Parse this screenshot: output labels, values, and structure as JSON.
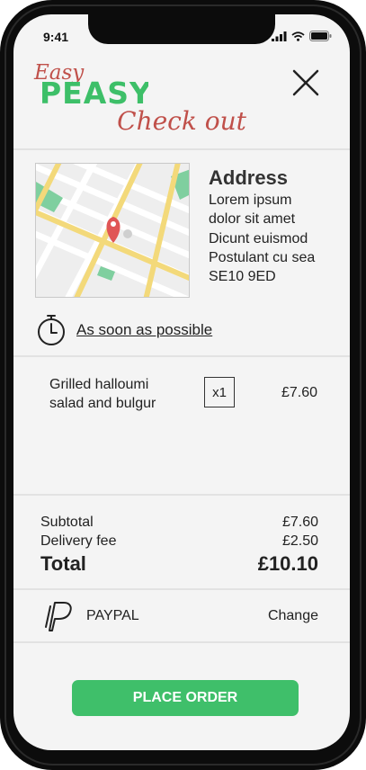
{
  "status_bar": {
    "time": "9:41"
  },
  "brand": {
    "logo_top": "Easy",
    "logo_main": "PEASY",
    "green": "#3dbf68",
    "red": "#c0504a"
  },
  "header": {
    "title": "Check out",
    "close_icon": "close-icon"
  },
  "address": {
    "heading": "Address",
    "lines": [
      "Lorem ipsum",
      "dolor sit amet",
      "Dicunt euismod",
      "Postulant cu sea",
      "SE10 9ED"
    ]
  },
  "delivery": {
    "time_label": "As soon as possible",
    "icon": "stopwatch-icon"
  },
  "order_items": [
    {
      "name_line1": "Grilled halloumi",
      "name_line2": "salad and bulgur",
      "quantity": "x1",
      "price": "£7.60"
    }
  ],
  "summary": {
    "subtotal_label": "Subtotal",
    "subtotal": "£7.60",
    "delivery_label": "Delivery fee",
    "delivery": "£2.50",
    "total_label": "Total",
    "total": "£10.10"
  },
  "payment": {
    "method": "PAYPAL",
    "change_label": "Change",
    "icon": "paypal-icon"
  },
  "cta": {
    "label": "PLACE ORDER",
    "color": "#3fbf6a"
  }
}
